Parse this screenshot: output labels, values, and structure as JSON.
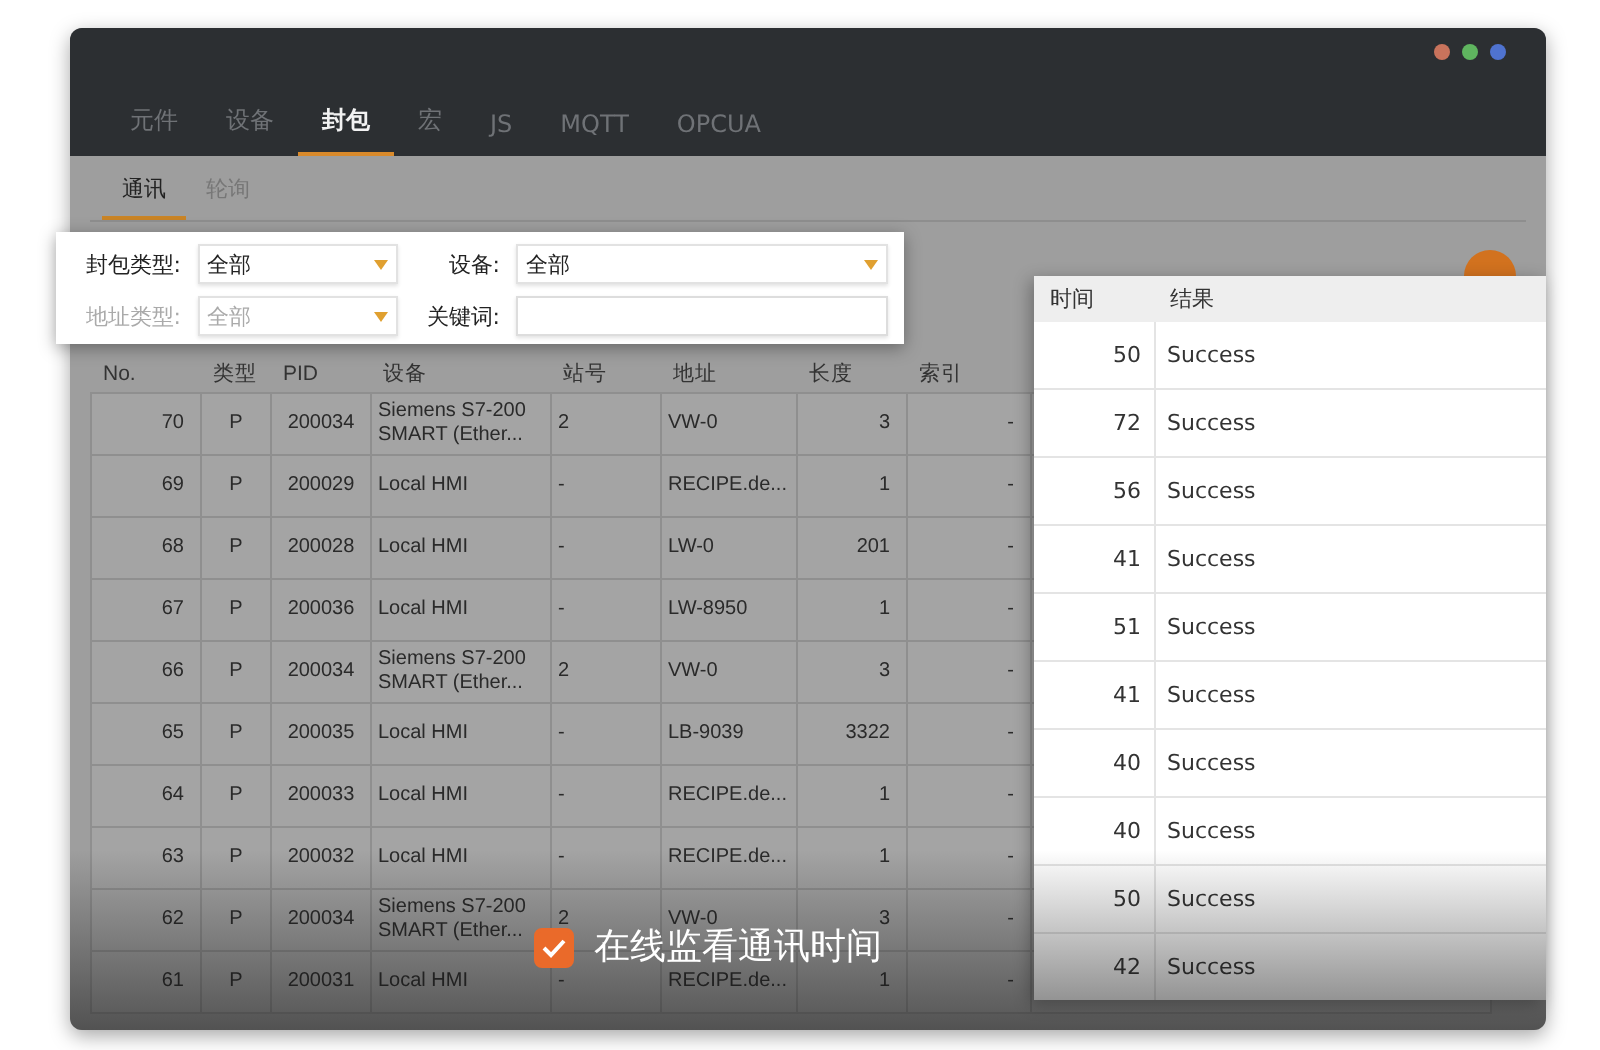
{
  "window": {
    "controls": [
      {
        "color": "#c8735c"
      },
      {
        "color": "#5fb55f"
      },
      {
        "color": "#4f73d0"
      }
    ]
  },
  "tabs": [
    {
      "label": "元件",
      "selected": false
    },
    {
      "label": "设备",
      "selected": false
    },
    {
      "label": "封包",
      "selected": true
    },
    {
      "label": "宏",
      "selected": false
    },
    {
      "label": "JS",
      "selected": false
    },
    {
      "label": "MQTT",
      "selected": false
    },
    {
      "label": "OPCUA",
      "selected": false
    }
  ],
  "subtabs": [
    {
      "label": "通讯",
      "selected": true
    },
    {
      "label": "轮询",
      "selected": false
    }
  ],
  "filters": [
    {
      "kind": "select",
      "label": "封包类型:",
      "value": "全部",
      "disabled": false
    },
    {
      "kind": "select",
      "label": "设备:",
      "value": "全部",
      "disabled": false
    },
    {
      "kind": "select",
      "label": "地址类型:",
      "value": "全部",
      "disabled": true
    },
    {
      "kind": "text",
      "label": "关键词:",
      "disabled": false
    }
  ],
  "table": {
    "columns": [
      "No.",
      "类型",
      "PID",
      "设备",
      "站号",
      "地址",
      "长度",
      "索引"
    ],
    "rows": [
      [
        "70",
        "P",
        "200034",
        "Siemens S7-200 SMART (Ether...",
        "2",
        "VW-0",
        "3",
        "-"
      ],
      [
        "69",
        "P",
        "200029",
        "Local HMI",
        "-",
        "RECIPE.de...",
        "1",
        "-"
      ],
      [
        "68",
        "P",
        "200028",
        "Local HMI",
        "-",
        "LW-0",
        "201",
        "-"
      ],
      [
        "67",
        "P",
        "200036",
        "Local HMI",
        "-",
        "LW-8950",
        "1",
        "-"
      ],
      [
        "66",
        "P",
        "200034",
        "Siemens S7-200 SMART (Ether...",
        "2",
        "VW-0",
        "3",
        "-"
      ],
      [
        "65",
        "P",
        "200035",
        "Local HMI",
        "-",
        "LB-9039",
        "3322",
        "-"
      ],
      [
        "64",
        "P",
        "200033",
        "Local HMI",
        "-",
        "RECIPE.de...",
        "1",
        "-"
      ],
      [
        "63",
        "P",
        "200032",
        "Local HMI",
        "-",
        "RECIPE.de...",
        "1",
        "-"
      ],
      [
        "62",
        "P",
        "200034",
        "Siemens S7-200 SMART (Ether...",
        "2",
        "VW-0",
        "3",
        "-"
      ],
      [
        "61",
        "P",
        "200031",
        "Local HMI",
        "-",
        "RECIPE.de...",
        "1",
        "-"
      ]
    ]
  },
  "result_panel": {
    "columns": [
      "时间",
      "结果"
    ],
    "rows": [
      [
        "50",
        "Success"
      ],
      [
        "72",
        "Success"
      ],
      [
        "56",
        "Success"
      ],
      [
        "41",
        "Success"
      ],
      [
        "51",
        "Success"
      ],
      [
        "41",
        "Success"
      ],
      [
        "40",
        "Success"
      ],
      [
        "40",
        "Success"
      ],
      [
        "50",
        "Success"
      ],
      [
        "42",
        "Success"
      ]
    ]
  },
  "caption": {
    "checked": true,
    "text": "在线监看通讯时间"
  }
}
